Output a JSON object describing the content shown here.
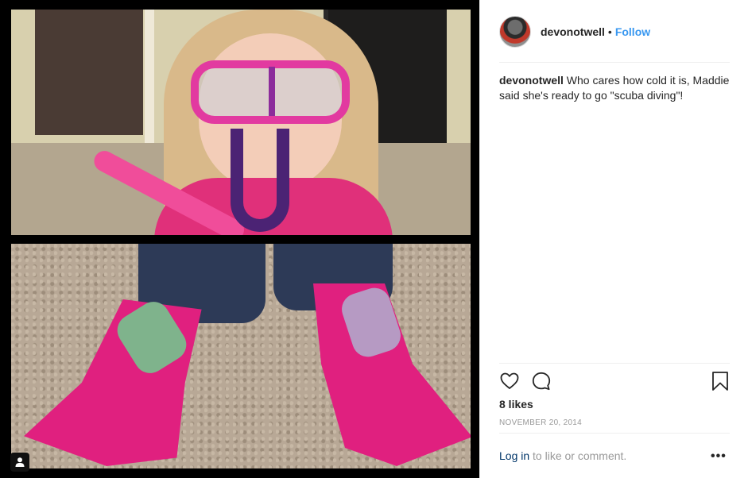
{
  "post": {
    "username": "devonotwell",
    "separator": "•",
    "follow_label": "Follow",
    "caption_user": "devonotwell",
    "caption_text": " Who cares how cold it is, Maddie said she's ready to go \"scuba diving\"!",
    "likes": "8 likes",
    "date": "NOVEMBER 20, 2014",
    "login_link": "Log in",
    "login_rest": " to like or comment.",
    "more_label": "•••"
  },
  "icons": {
    "like": "heart-icon",
    "comment": "comment-icon",
    "save": "bookmark-icon",
    "user_tag": "user-tag-icon",
    "more": "more-options-icon"
  },
  "colors": {
    "follow": "#3897f0",
    "link": "#003569",
    "muted": "#999999",
    "text": "#262626"
  }
}
